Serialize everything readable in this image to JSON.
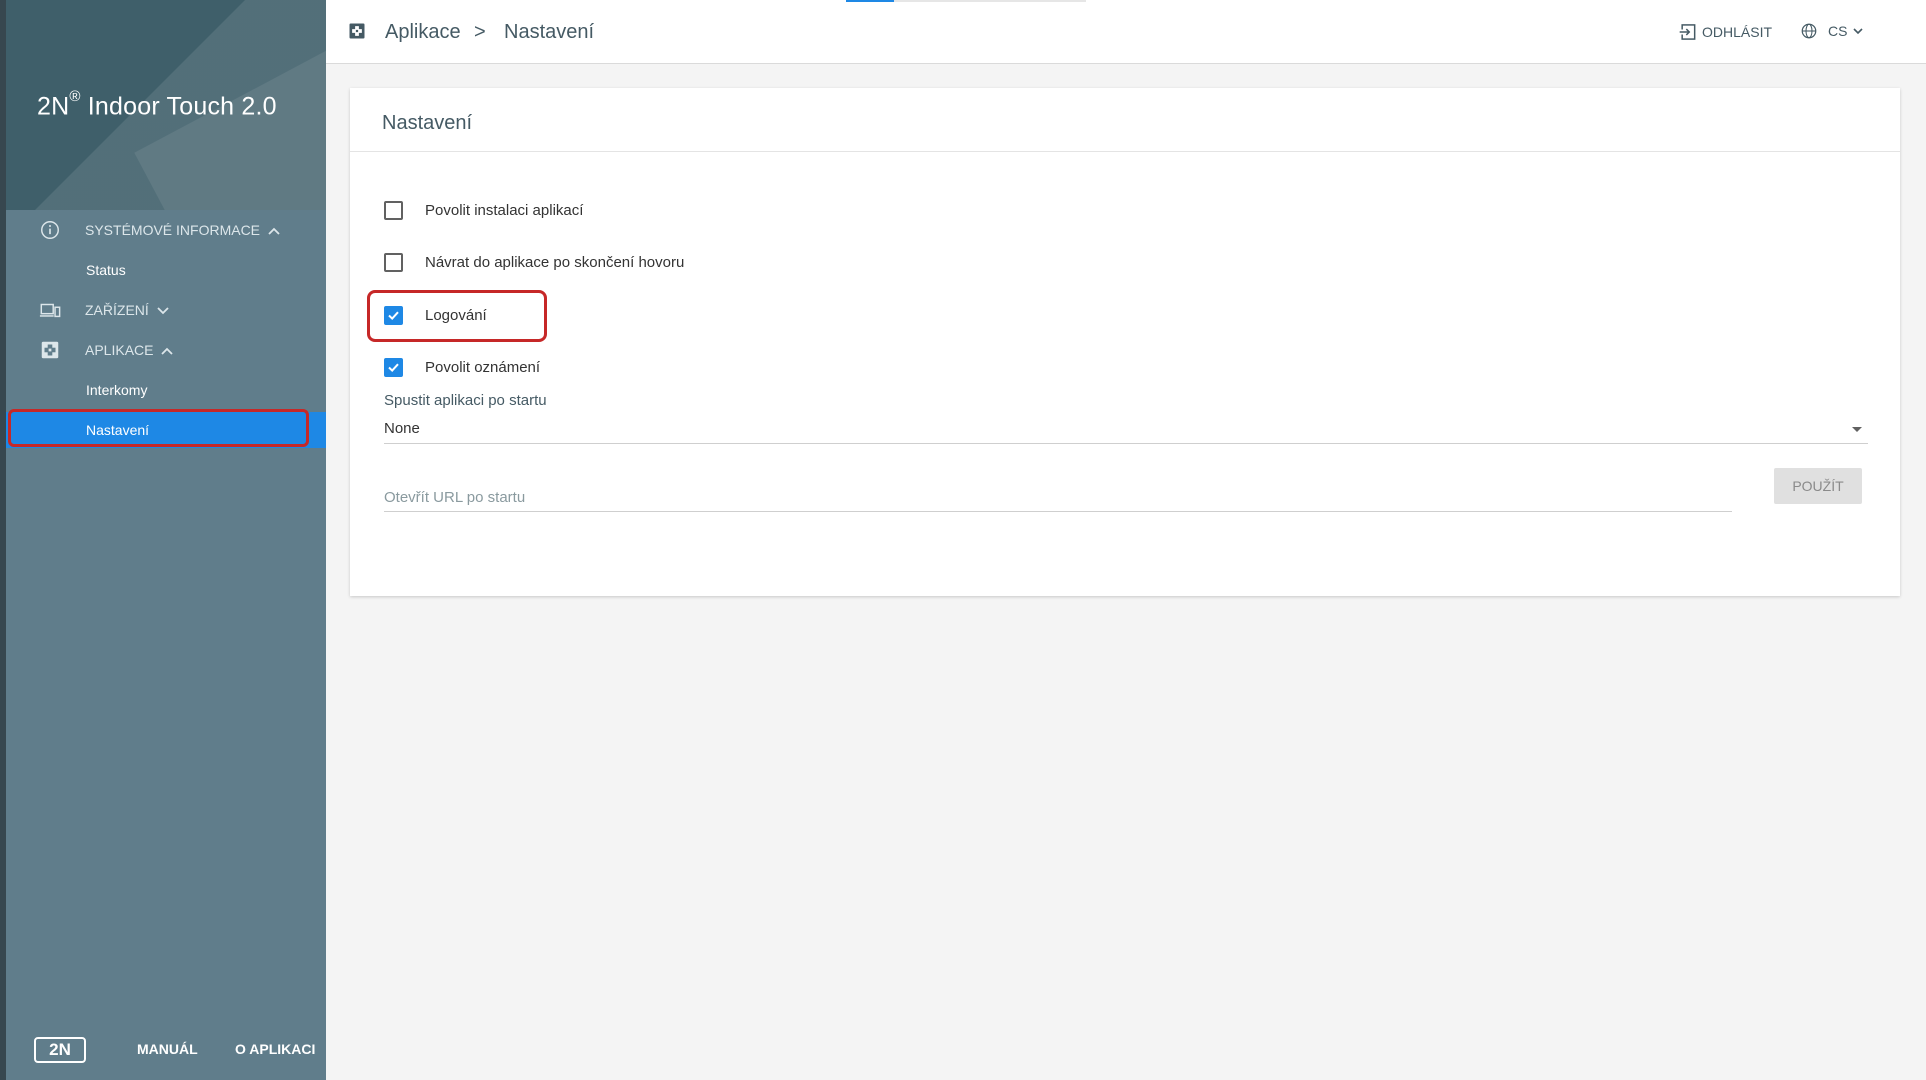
{
  "app": {
    "brand_main": "2N",
    "brand_reg": "®",
    "brand_rest": " Indoor Touch 2.0"
  },
  "sidebar": {
    "sections": [
      {
        "label": "Systémové informace",
        "icon": "info-icon",
        "expanded": true,
        "items": [
          {
            "label": "Status",
            "active": false
          }
        ]
      },
      {
        "label": "Zařízení",
        "icon": "devices-icon",
        "expanded": false,
        "items": []
      },
      {
        "label": "Aplikace",
        "icon": "apps-icon",
        "expanded": true,
        "items": [
          {
            "label": "Interkomy",
            "active": false
          },
          {
            "label": "Nastavení",
            "active": true
          }
        ]
      }
    ],
    "footer": {
      "logo_text": "2N",
      "manual": "MANUÁL",
      "about": "O APLIKACI"
    }
  },
  "topbar": {
    "breadcrumb": [
      "Aplikace",
      "Nastavení"
    ],
    "separator": ">",
    "logout": "ODHLÁSIT",
    "language": "CS"
  },
  "card": {
    "title": "Nastavení",
    "checkboxes": [
      {
        "label": "Povolit instalaci aplikací",
        "checked": false
      },
      {
        "label": "Návrat do aplikace po skončení hovoru",
        "checked": false
      },
      {
        "label": "Logování",
        "checked": true
      },
      {
        "label": "Povolit oznámení",
        "checked": true
      }
    ],
    "startup_label": "Spustit aplikaci po startu",
    "startup_value": "None",
    "url_placeholder": "Otevřít URL po startu",
    "apply": "POUŽÍT"
  },
  "colors": {
    "sidebar": "#607d8b",
    "sidebar_header": "#3f5f6a",
    "accent": "#1e88e5",
    "highlight": "#c62828"
  }
}
